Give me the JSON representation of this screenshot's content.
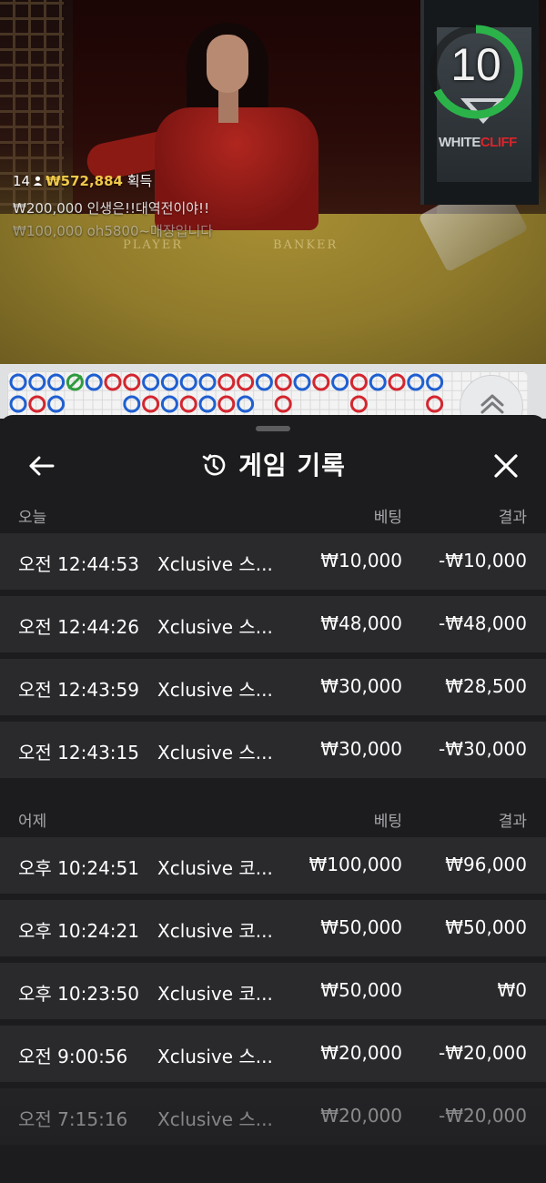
{
  "live": {
    "timer": "10",
    "brand_white": "WHITE",
    "brand_cliff": "CLIFF",
    "table_labels": {
      "player": "PLAYER",
      "banker": "BANKER"
    },
    "feed": [
      {
        "count": "14",
        "amount": "₩572,884",
        "suffix": "획득"
      },
      {
        "text": "₩200,000  인생은!!대역전이야!!"
      },
      {
        "text": "₩100,000  oh5800~매장입니다"
      }
    ],
    "colors": {
      "player_blue": "#1f5fd1",
      "banker_red": "#d3262f",
      "tie_green": "#2e9b3e",
      "timer_green": "#2bb34a"
    }
  },
  "roadmap": {
    "icon": "chevron-up-icon"
  },
  "history": {
    "title": "게임 기록",
    "title_icon": "history-icon",
    "back_icon": "back-arrow-icon",
    "close_icon": "close-icon",
    "sections": [
      {
        "label": "오늘",
        "bet_header": "베팅",
        "result_header": "결과",
        "rows": [
          {
            "time": "오전 12:44:53",
            "game": "Xclusive 스...",
            "bet": "₩10,000",
            "result": "-₩10,000"
          },
          {
            "time": "오전 12:44:26",
            "game": "Xclusive 스...",
            "bet": "₩48,000",
            "result": "-₩48,000"
          },
          {
            "time": "오전 12:43:59",
            "game": "Xclusive 스...",
            "bet": "₩30,000",
            "result": "₩28,500"
          },
          {
            "time": "오전 12:43:15",
            "game": "Xclusive 스...",
            "bet": "₩30,000",
            "result": "-₩30,000"
          }
        ]
      },
      {
        "label": "어제",
        "bet_header": "베팅",
        "result_header": "결과",
        "rows": [
          {
            "time": "오후 10:24:51",
            "game": "Xclusive 코...",
            "bet": "₩100,000",
            "result": "₩96,000"
          },
          {
            "time": "오후 10:24:21",
            "game": "Xclusive 코...",
            "bet": "₩50,000",
            "result": "₩50,000"
          },
          {
            "time": "오후 10:23:50",
            "game": "Xclusive 코...",
            "bet": "₩50,000",
            "result": "₩0"
          },
          {
            "time": "오전 9:00:56",
            "game": "Xclusive 스...",
            "bet": "₩20,000",
            "result": "-₩20,000"
          },
          {
            "time": "오전 7:15:16",
            "game": "Xclusive 스...",
            "bet": "₩20,000",
            "result": "-₩20,000"
          }
        ]
      }
    ]
  }
}
